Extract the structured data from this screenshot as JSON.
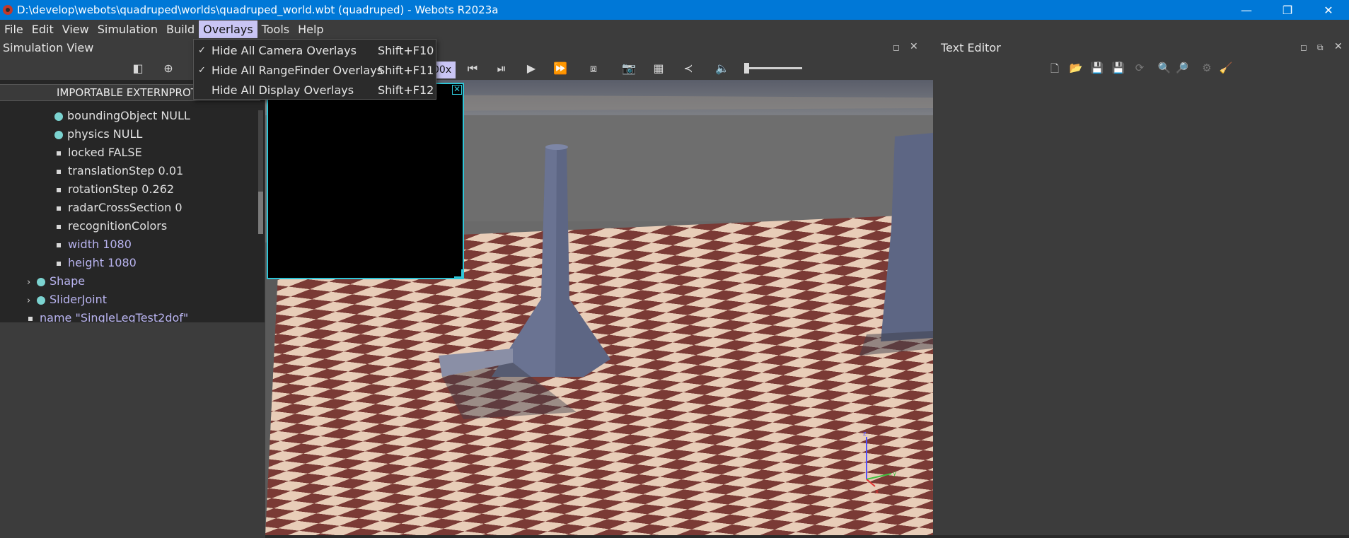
{
  "window": {
    "title": "D:\\develop\\webots\\quadruped\\worlds\\quadruped_world.wbt (quadruped) - Webots R2023a",
    "minimize": "—",
    "restore": "❐",
    "close": "✕"
  },
  "menubar": {
    "items": [
      {
        "label": "File"
      },
      {
        "label": "Edit"
      },
      {
        "label": "View"
      },
      {
        "label": "Simulation"
      },
      {
        "label": "Build"
      },
      {
        "label": "Overlays"
      },
      {
        "label": "Tools"
      },
      {
        "label": "Help"
      }
    ]
  },
  "overlays_menu": {
    "items": [
      {
        "label": "Hide All Camera Overlays",
        "shortcut": "Shift+F10",
        "checked": "✓"
      },
      {
        "label": "Hide All RangeFinder Overlays",
        "shortcut": "Shift+F11",
        "checked": "✓"
      },
      {
        "label": "Hide All Display Overlays",
        "shortcut": "Shift+F12",
        "checked": ""
      }
    ]
  },
  "simulation_view": {
    "title": "Simulation View",
    "speed": "00x"
  },
  "scene_tree": {
    "header": "IMPORTABLE EXTERNPROTO",
    "rows": [
      {
        "text": "boundingObject NULL"
      },
      {
        "text": "physics NULL"
      },
      {
        "text": "locked FALSE"
      },
      {
        "text": "translationStep 0.01"
      },
      {
        "text": "rotationStep 0.262"
      },
      {
        "text": "radarCrossSection 0"
      },
      {
        "text": "recognitionColors"
      },
      {
        "text": "width 1080"
      },
      {
        "text": "height 1080"
      },
      {
        "text": "Shape"
      },
      {
        "text": "SliderJoint"
      },
      {
        "text": "name \"SingleLegTest2dof\""
      }
    ]
  },
  "text_editor": {
    "title": "Text Editor"
  },
  "axes": {
    "z": "z",
    "y": "y",
    "x": "x"
  },
  "colors": {
    "titlebar": "#0078d7",
    "menu_highlight": "#c9c5f4",
    "overlay_border": "#2fc6d8",
    "floor_dark": "#7a3a35",
    "floor_light": "#e8cdb8"
  }
}
